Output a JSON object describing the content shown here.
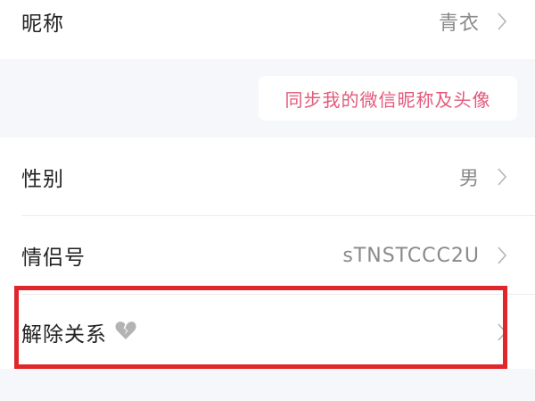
{
  "profile": {
    "nickname": {
      "label": "昵称",
      "value": "青衣"
    },
    "sync_button": "同步我的微信昵称及头像",
    "gender": {
      "label": "性别",
      "value": "男"
    },
    "couple_id": {
      "label": "情侣号",
      "value": "sTNSTCCC2U"
    },
    "unbind": {
      "label": "解除关系"
    }
  },
  "icons": {
    "chevron": "chevron-right-icon",
    "broken_heart": "broken-heart-icon"
  },
  "colors": {
    "accent_pink": "#e4587a",
    "highlight_red": "#e1262b",
    "background": "#f6f7fa"
  }
}
